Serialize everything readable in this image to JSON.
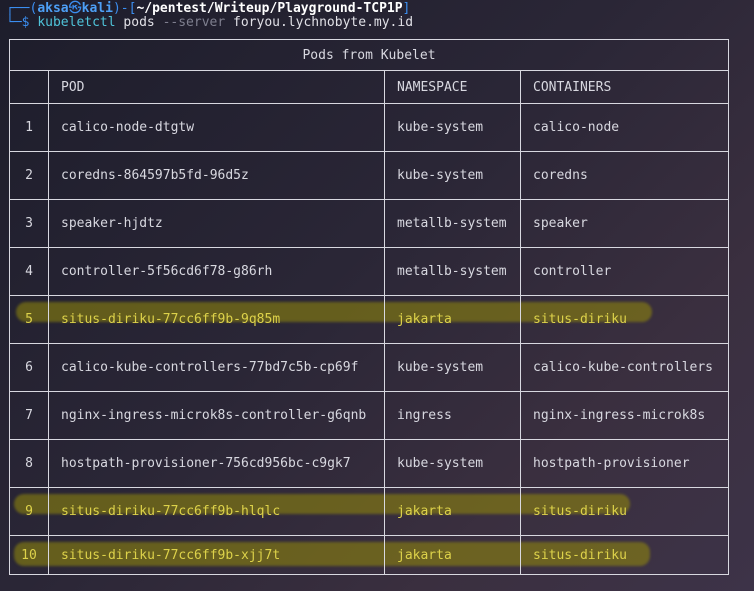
{
  "prompt": {
    "corner_top": "┌──(",
    "user": "aksa",
    "at_icon": "㉿",
    "host": "kali",
    "mid": ")-[",
    "path": "~/pentest/Writeup/Playground-TCP1P",
    "end": "]",
    "corner_bottom": "└─",
    "dollar": "$ ",
    "command": "kubeletctl",
    "subcommand": " pods ",
    "flag": "--server",
    "argument": " foryou.lychnobyte.my.id"
  },
  "table": {
    "title": "Pods from Kubelet",
    "headers": {
      "index": "",
      "pod": "POD",
      "namespace": "NAMESPACE",
      "containers": "CONTAINERS"
    },
    "rows": [
      {
        "index": "1",
        "pod": "calico-node-dtgtw",
        "namespace": "kube-system",
        "containers": "calico-node"
      },
      {
        "index": "2",
        "pod": "coredns-864597b5fd-96d5z",
        "namespace": "kube-system",
        "containers": "coredns"
      },
      {
        "index": "3",
        "pod": "speaker-hjdtz",
        "namespace": "metallb-system",
        "containers": "speaker"
      },
      {
        "index": "4",
        "pod": "controller-5f56cd6f78-g86rh",
        "namespace": "metallb-system",
        "containers": "controller"
      },
      {
        "index": "5",
        "pod": "situs-diriku-77cc6ff9b-9q85m",
        "namespace": "jakarta",
        "containers": "situs-diriku"
      },
      {
        "index": "6",
        "pod": "calico-kube-controllers-77bd7c5b-cp69f",
        "namespace": "kube-system",
        "containers": "calico-kube-controllers"
      },
      {
        "index": "7",
        "pod": "nginx-ingress-microk8s-controller-g6qnb",
        "namespace": "ingress",
        "containers": "nginx-ingress-microk8s"
      },
      {
        "index": "8",
        "pod": "hostpath-provisioner-756cd956bc-c9gk7",
        "namespace": "kube-system",
        "containers": "hostpath-provisioner"
      },
      {
        "index": "9",
        "pod": "situs-diriku-77cc6ff9b-hlqlc",
        "namespace": "jakarta",
        "containers": "situs-diriku"
      },
      {
        "index": "10",
        "pod": "situs-diriku-77cc6ff9b-xjj7t",
        "namespace": "jakarta",
        "containers": "situs-diriku"
      }
    ]
  },
  "colors": {
    "prompt_blue": "#3b8ef0",
    "command_cyan": "#4fc3d9",
    "highlight_text": "#ddd24a",
    "highlight_marker": "#968c0a"
  }
}
